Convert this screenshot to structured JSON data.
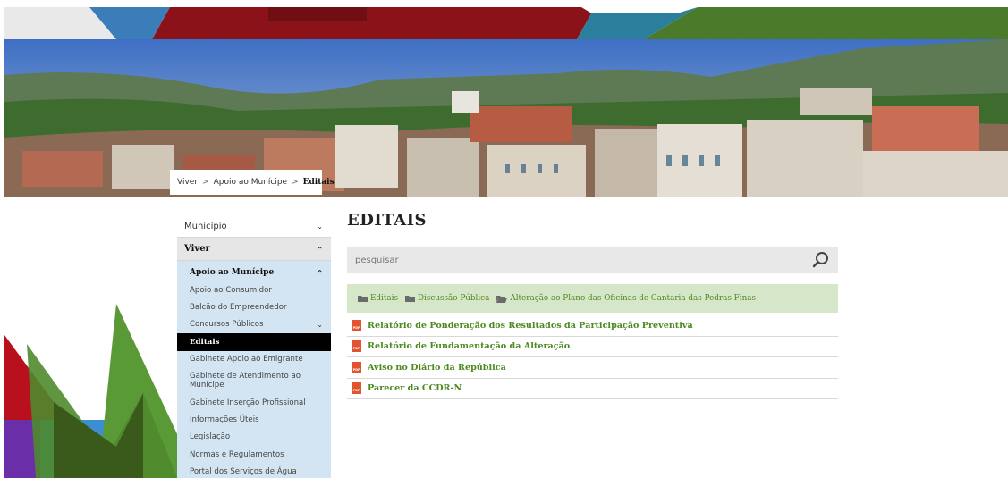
{
  "breadcrumb": {
    "items": [
      "Viver",
      "Apoio ao Munícipe"
    ],
    "current": "Editais"
  },
  "sidebar": {
    "top_items": [
      "Município",
      "Viver"
    ],
    "section": "Apoio ao Munícipe",
    "items": [
      "Apoio ao Consumidor",
      "Balcão do Empreendedor",
      "Concursos Públicos",
      "Editais",
      "Gabinete Apoio ao Emigrante",
      "Gabinete de Atendimento ao Munícipe",
      "Gabinete Inserção Profissional",
      "Informações Úteis",
      "Legislação",
      "Normas e Regulamentos",
      "Portal dos Serviços de Água"
    ],
    "active_item": "Editais"
  },
  "main": {
    "title": "EDITAIS",
    "search_placeholder": "pesquisar",
    "folders": [
      "Editais",
      "Discussão Pública",
      "Alteração ao Plano das Oficinas de Cantaria das Pedras Finas"
    ],
    "files": [
      "Relatório de Ponderação dos Resultados da Participação Preventiva",
      "Relatório de Fundamentação da Alteração",
      "Aviso no Diário da República",
      "Parecer da CCDR-N"
    ],
    "pdf_badge": "PDF"
  },
  "icons": {
    "search": "search-icon",
    "folder": "folder-icon",
    "open_folder": "folder-open-icon",
    "pdf": "pdf-icon",
    "chevron_down": "chevron-down-icon",
    "chevron_up": "chevron-up-icon"
  },
  "colors": {
    "green_link": "#4a8a1f",
    "folder_bar": "#d6e7c9",
    "sidebar_bg": "#d3e5f3",
    "active_bg": "#000000",
    "pdf_red": "#e2542f"
  }
}
